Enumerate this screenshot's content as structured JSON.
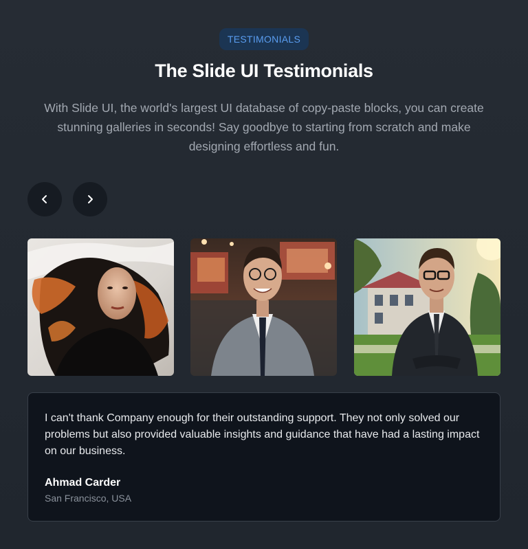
{
  "badge": "TESTIMONIALS",
  "title": "The Slide UI Testimonials",
  "description": "With Slide UI, the world's largest UI database of copy-paste blocks, you can create stunning galleries in seconds! Say goodbye to starting from scratch and make designing effortless and fun.",
  "nav": {
    "prev_icon": "chevron-left-icon",
    "next_icon": "chevron-right-icon"
  },
  "photos": [
    {
      "subject": "woman-flowing-hair-portrait"
    },
    {
      "subject": "man-grey-suit-glasses-portrait"
    },
    {
      "subject": "man-dark-suit-glasses-outdoor-portrait"
    }
  ],
  "testimonial": {
    "quote": "I can't thank Company enough for their outstanding support. They not only solved our problems but also provided valuable insights and guidance that have had a lasting impact on our business.",
    "name": "Ahmad Carder",
    "location": "San Francisco, USA"
  },
  "colors": {
    "background": "#232930",
    "badge_bg": "#1b3553",
    "badge_text": "#5a9df0",
    "card_bg": "#0f141c",
    "button_bg": "#161b22"
  }
}
